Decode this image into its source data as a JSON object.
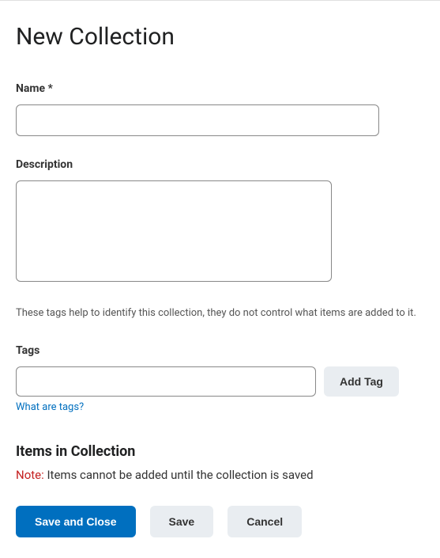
{
  "page": {
    "title": "New Collection"
  },
  "fields": {
    "name": {
      "label": "Name *",
      "value": ""
    },
    "description": {
      "label": "Description",
      "value": ""
    },
    "tags": {
      "label": "Tags",
      "value": "",
      "helper": "These tags help to identify this collection, they do not control what items are added to it.",
      "add_button": "Add Tag",
      "help_link": "What are tags?"
    }
  },
  "items_section": {
    "heading": "Items in Collection",
    "note_prefix": "Note:",
    "note_body": " Items cannot be added until the collection is saved"
  },
  "buttons": {
    "save_close": "Save and Close",
    "save": "Save",
    "cancel": "Cancel"
  }
}
